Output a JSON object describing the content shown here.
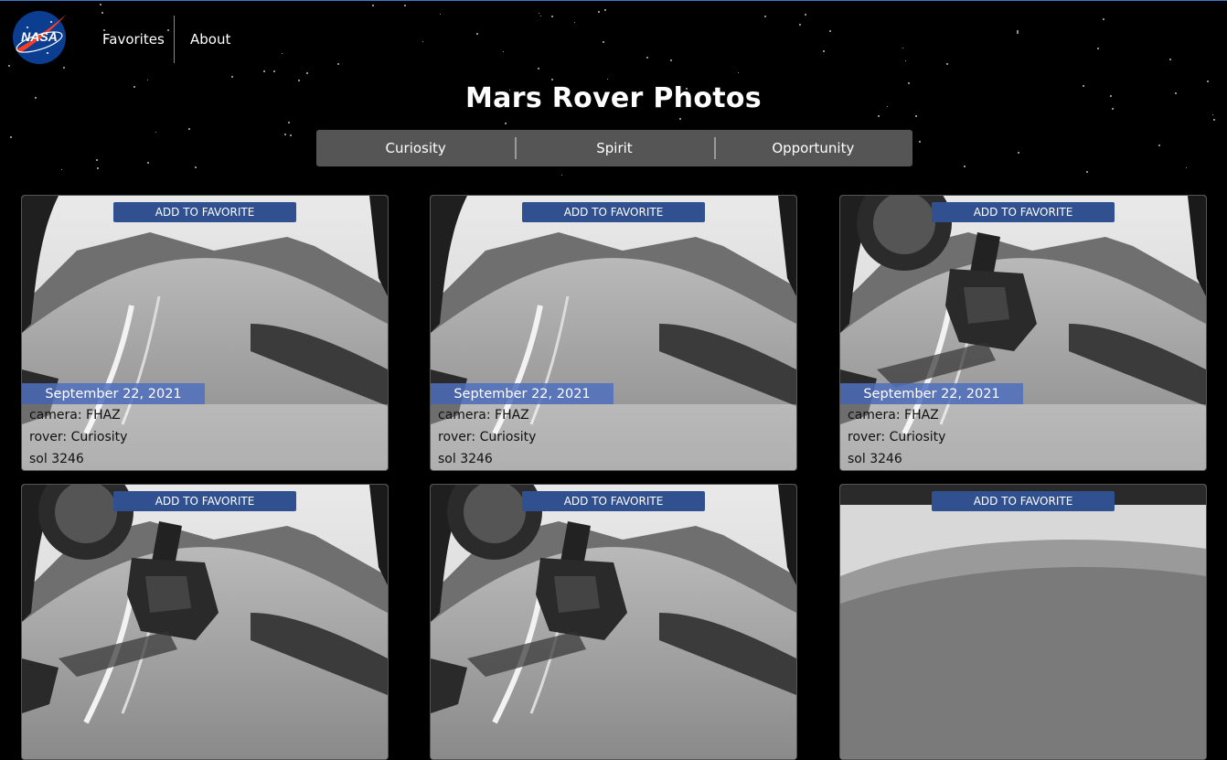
{
  "header": {
    "logo_text": "NASA",
    "nav": {
      "favorites": "Favorites",
      "about": "About"
    }
  },
  "page": {
    "title": "Mars Rover Photos"
  },
  "rover_tabs": [
    "Curiosity",
    "Spirit",
    "Opportunity"
  ],
  "cards": [
    {
      "button": "ADD TO FAVORITE",
      "date": "September 22, 2021",
      "camera": "camera: FHAZ",
      "rover": "rover: Curiosity",
      "sol": "sol 3246",
      "image": "mars-terrain-slope"
    },
    {
      "button": "ADD TO FAVORITE",
      "date": "September 22, 2021",
      "camera": "camera: FHAZ",
      "rover": "rover: Curiosity",
      "sol": "sol 3246",
      "image": "mars-terrain-slope"
    },
    {
      "button": "ADD TO FAVORITE",
      "date": "September 22, 2021",
      "camera": "camera: FHAZ",
      "rover": "rover: Curiosity",
      "sol": "sol 3246",
      "image": "mars-terrain-robotic-arm"
    },
    {
      "button": "ADD TO FAVORITE",
      "image": "mars-terrain-robotic-arm"
    },
    {
      "button": "ADD TO FAVORITE",
      "image": "mars-terrain-robotic-arm"
    },
    {
      "button": "ADD TO FAVORITE",
      "image": "mars-horizon-fisheye"
    }
  ]
}
